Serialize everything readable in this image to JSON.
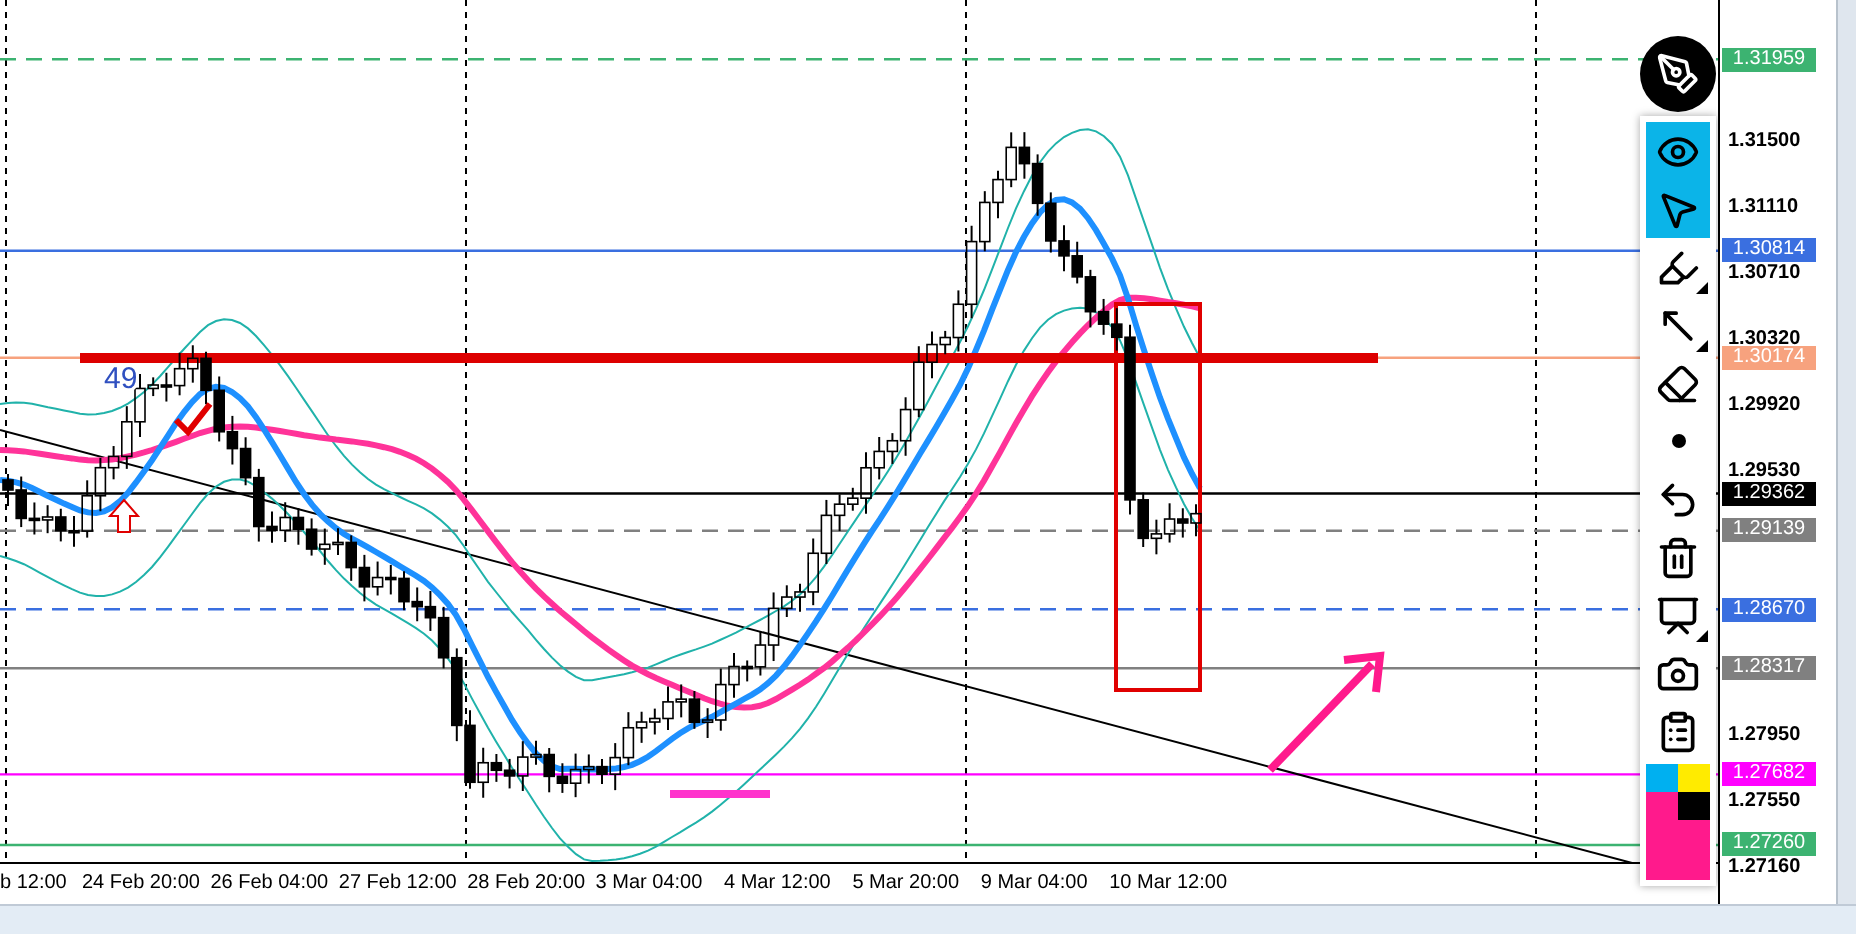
{
  "chart": {
    "annotation": "49"
  },
  "price_axis": {
    "ticks": [
      "1.31500",
      "1.31110",
      "1.30710",
      "1.30320",
      "1.29920",
      "1.29530",
      "1.27950",
      "1.27550",
      "1.27160"
    ]
  },
  "price_tags": [
    {
      "value": "1.31959",
      "color": "#3cb371",
      "dashed": true
    },
    {
      "value": "1.30814",
      "color": "#3a6fe0",
      "dashed": false
    },
    {
      "value": "1.30174",
      "color": "#f7a27e",
      "dashed": false
    },
    {
      "value": "1.29362",
      "color": "#000000",
      "dashed": false
    },
    {
      "value": "1.29139",
      "color": "#808080",
      "dashed": true
    },
    {
      "value": "1.28670",
      "color": "#3a6fe0",
      "dashed": true
    },
    {
      "value": "1.28317",
      "color": "#808080",
      "dashed": false
    },
    {
      "value": "1.27682",
      "color": "#ff00ff",
      "dashed": false
    },
    {
      "value": "1.27260",
      "color": "#3cb371",
      "dashed": false
    }
  ],
  "time_axis": [
    "b 12:00",
    "24 Feb 20:00",
    "26 Feb 04:00",
    "27 Feb 12:00",
    "28 Feb 20:00",
    "3 Mar 04:00",
    "4 Mar 12:00",
    "5 Mar 20:00",
    "9 Mar 04:00",
    "10 Mar 12:00"
  ],
  "toolbar": {
    "tools": [
      {
        "kind": "eye",
        "selected": true,
        "submenu": false
      },
      {
        "kind": "cursor",
        "selected": true,
        "submenu": false
      },
      {
        "kind": "highlighter",
        "selected": false,
        "submenu": true
      },
      {
        "kind": "arrow",
        "selected": false,
        "submenu": true
      },
      {
        "kind": "eraser",
        "selected": false,
        "submenu": false
      },
      {
        "kind": "dot",
        "selected": false,
        "submenu": false
      },
      {
        "kind": "undo",
        "selected": false,
        "submenu": false
      },
      {
        "kind": "trash",
        "selected": false,
        "submenu": false
      },
      {
        "kind": "easel",
        "selected": false,
        "submenu": true
      },
      {
        "kind": "camera",
        "selected": false,
        "submenu": false
      },
      {
        "kind": "clipboard",
        "selected": false,
        "submenu": false
      }
    ],
    "palette": [
      {
        "color": "#00b0f0"
      },
      {
        "color": "#ffeb00"
      },
      {
        "color": "#ff1a8c"
      },
      {
        "color": "#000000"
      }
    ]
  }
}
